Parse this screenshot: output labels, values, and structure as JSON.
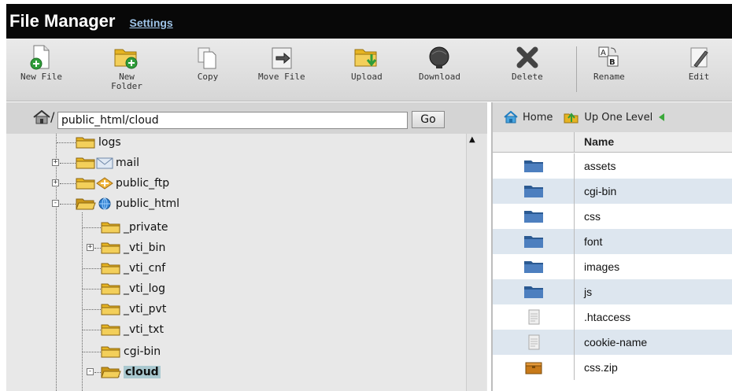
{
  "header": {
    "title": "File Manager",
    "settings_link": "Settings"
  },
  "toolbar": [
    {
      "label": "New File",
      "icon": "new-file-icon"
    },
    {
      "label": "New Folder",
      "icon": "new-folder-icon"
    },
    {
      "label": "Copy",
      "icon": "copy-icon"
    },
    {
      "label": "Move File",
      "icon": "move-file-icon"
    },
    {
      "label": "Upload",
      "icon": "upload-icon"
    },
    {
      "label": "Download",
      "icon": "download-icon"
    },
    {
      "label": "Delete",
      "icon": "delete-icon"
    },
    {
      "label": "Rename",
      "icon": "rename-icon"
    },
    {
      "label": "Edit",
      "icon": "edit-icon"
    }
  ],
  "path": {
    "value": "public_html/cloud",
    "slash": "/",
    "go_label": "Go"
  },
  "tree": [
    {
      "label": "logs",
      "expander": ""
    },
    {
      "label": "mail",
      "expander": "+"
    },
    {
      "label": "public_ftp",
      "expander": "+"
    },
    {
      "label": "public_html",
      "expander": "-"
    },
    {
      "label": "_private",
      "expander": ""
    },
    {
      "label": "_vti_bin",
      "expander": "+"
    },
    {
      "label": "_vti_cnf",
      "expander": ""
    },
    {
      "label": "_vti_log",
      "expander": ""
    },
    {
      "label": "_vti_pvt",
      "expander": ""
    },
    {
      "label": "_vti_txt",
      "expander": ""
    },
    {
      "label": "cgi-bin",
      "expander": ""
    },
    {
      "label": "cloud",
      "expander": "-",
      "selected": true
    }
  ],
  "nav": {
    "home": "Home",
    "up": "Up One Level"
  },
  "table": {
    "header": "Name",
    "rows": [
      {
        "name": "assets",
        "type": "folder"
      },
      {
        "name": "cgi-bin",
        "type": "folder"
      },
      {
        "name": "css",
        "type": "folder"
      },
      {
        "name": "font",
        "type": "folder"
      },
      {
        "name": "images",
        "type": "folder"
      },
      {
        "name": "js",
        "type": "folder"
      },
      {
        "name": ".htaccess",
        "type": "file"
      },
      {
        "name": "cookie-name",
        "type": "file"
      },
      {
        "name": "css.zip",
        "type": "archive"
      }
    ]
  },
  "colors": {
    "header_bg": "#080808",
    "settings_link": "#9fc4e8",
    "selected_bg": "#a9c8cf",
    "row_alt": "#dde6ef",
    "folder_blue": "#3f6fa8",
    "folder_yellow": "#e6b422"
  }
}
